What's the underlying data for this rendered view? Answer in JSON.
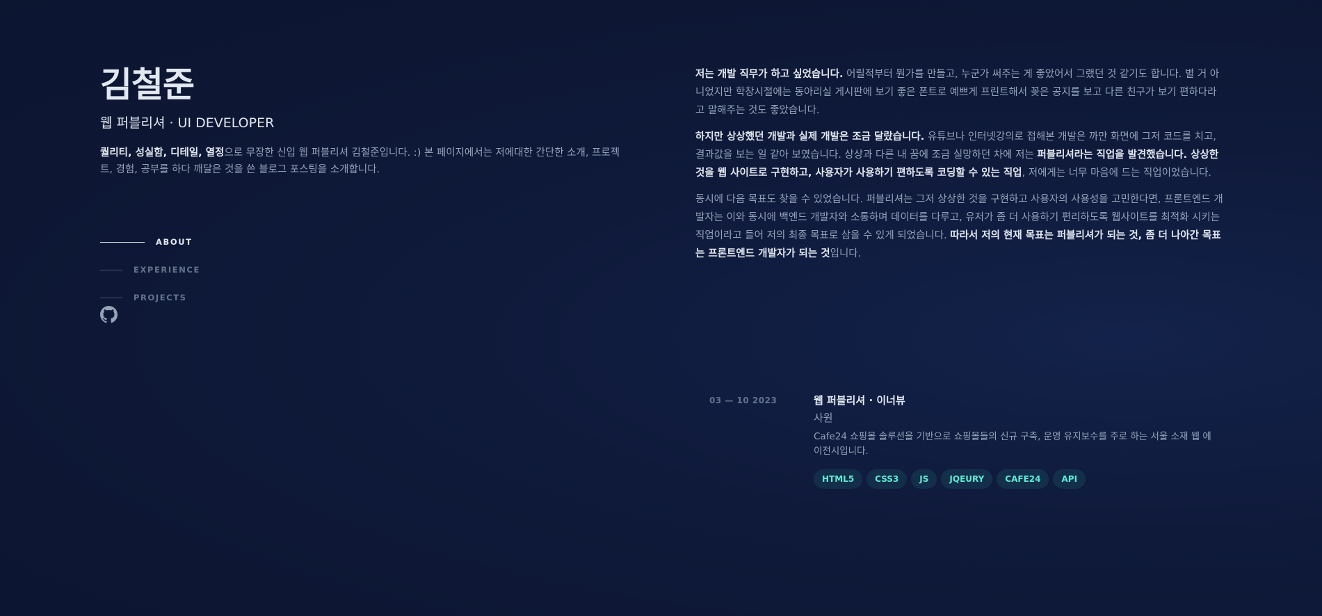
{
  "profile": {
    "name": "김철준",
    "role": "웹 퍼블리셔 · UI DEVELOPER",
    "intro_bold": "퀄리티, 성실함, 디테일, 열정",
    "intro_rest": "으로 무장한 신입 웹 퍼블리셔 김철준입니다. :) 본 페이지에서는 저에대한 간단한 소개, 프로젝트, 경험, 공부를 하다 깨달은 것을 쓴 블로그 포스팅을 소개합니다."
  },
  "nav": {
    "items": [
      {
        "label": "ABOUT",
        "active": true
      },
      {
        "label": "EXPERIENCE",
        "active": false
      },
      {
        "label": "PROJECTS",
        "active": false
      }
    ],
    "github_icon": "github-icon"
  },
  "about": {
    "p1_bold": "저는 개발 직무가 하고 싶었습니다.",
    "p1_rest": " 어릴적부터 뭔가를 만들고, 누군가 써주는 게 좋았어서 그랬던 것 같기도 합니다. 별 거 아니었지만 학창시절에는 동아리실 게시판에 보기 좋은 폰트로 예쁘게 프린트해서 꽂은 공지를 보고 다른 친구가 보기 편하다라고 말해주는 것도 좋았습니다.",
    "p2_bold1": "하지만 상상했던 개발과 실제 개발은 조금 달랐습니다.",
    "p2_text1": " 유튜브나 인터넷강의로 접해본 개발은 까만 화면에 그저 코드를 치고, 결과값을 보는 일 같아 보였습니다. 상상과 다른 내 꿈에 조금 실망하던 차에 저는 ",
    "p2_bold2": "퍼블리셔라는 직업을 발견했습니다. 상상한 것을 웹 사이트로 구현하고, 사용자가 사용하기 편하도록 코딩할 수 있는 직업",
    "p2_text2": ", 저에게는 너무 마음에 드는 직업이었습니다.",
    "p3_text": "동시에 다음 목표도 찾을 수 있었습니다. 퍼블리셔는 그저 상상한 것을 구현하고 사용자의 사용성을 고민한다면, 프론트엔드 개발자는 이와 동시에 백엔드 개발자와 소통하며 데이터를 다루고, 유저가 좀 더 사용하기 편리하도록 웹사이트를 최적화 시키는 직업이라고 들어 저의 최종 목표로 삼을 수 있게 되었습니다. ",
    "p3_bold": "따라서 저의 현재 목표는 퍼블리셔가 되는 것, 좀 더 나아간 목표는 프론트엔드 개발자가 되는 것",
    "p3_end": "입니다."
  },
  "experience": {
    "date": "03 — 10 2023",
    "title": "웹 퍼블리셔 · 이너뷰",
    "position": "사원",
    "description": "Cafe24 쇼핑몰 솔루션을 기반으로 쇼핑몰들의 신규 구축, 운영 유지보수를 주로 하는 서울 소재 웹 에이전시입니다.",
    "tags": [
      "HTML5",
      "CSS3",
      "JS",
      "JQEURY",
      "CAFE24",
      "API"
    ]
  }
}
